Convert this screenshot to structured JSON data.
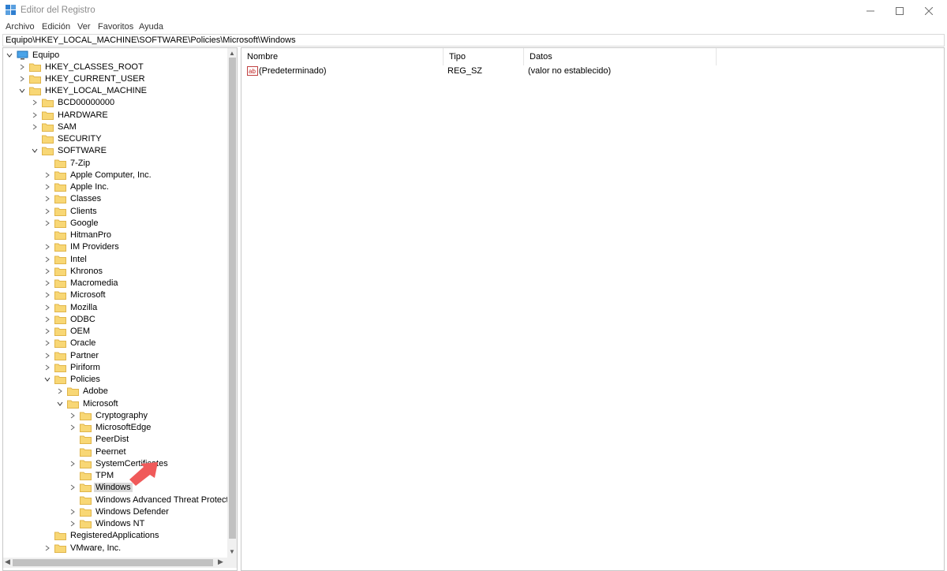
{
  "window": {
    "title": "Editor del Registro",
    "controls": {
      "minimize": "minimize-icon",
      "maximize": "maximize-icon",
      "close": "close-icon"
    }
  },
  "menu": [
    "Archivo",
    "Edición",
    "Ver",
    "Favoritos",
    "Ayuda"
  ],
  "address": "Equipo\\HKEY_LOCAL_MACHINE\\SOFTWARE\\Policies\\Microsoft\\Windows",
  "tree": {
    "root": "Equipo",
    "nodes": [
      {
        "label": "HKEY_CLASSES_ROOT",
        "depth": 1,
        "state": "collapsed"
      },
      {
        "label": "HKEY_CURRENT_USER",
        "depth": 1,
        "state": "collapsed"
      },
      {
        "label": "HKEY_LOCAL_MACHINE",
        "depth": 1,
        "state": "expanded"
      },
      {
        "label": "BCD00000000",
        "depth": 2,
        "state": "collapsed"
      },
      {
        "label": "HARDWARE",
        "depth": 2,
        "state": "collapsed"
      },
      {
        "label": "SAM",
        "depth": 2,
        "state": "collapsed"
      },
      {
        "label": "SECURITY",
        "depth": 2,
        "state": "leaf"
      },
      {
        "label": "SOFTWARE",
        "depth": 2,
        "state": "expanded"
      },
      {
        "label": "7-Zip",
        "depth": 3,
        "state": "leaf"
      },
      {
        "label": "Apple Computer, Inc.",
        "depth": 3,
        "state": "collapsed"
      },
      {
        "label": "Apple Inc.",
        "depth": 3,
        "state": "collapsed"
      },
      {
        "label": "Classes",
        "depth": 3,
        "state": "collapsed"
      },
      {
        "label": "Clients",
        "depth": 3,
        "state": "collapsed"
      },
      {
        "label": "Google",
        "depth": 3,
        "state": "collapsed"
      },
      {
        "label": "HitmanPro",
        "depth": 3,
        "state": "leaf"
      },
      {
        "label": "IM Providers",
        "depth": 3,
        "state": "collapsed"
      },
      {
        "label": "Intel",
        "depth": 3,
        "state": "collapsed"
      },
      {
        "label": "Khronos",
        "depth": 3,
        "state": "collapsed"
      },
      {
        "label": "Macromedia",
        "depth": 3,
        "state": "collapsed"
      },
      {
        "label": "Microsoft",
        "depth": 3,
        "state": "collapsed"
      },
      {
        "label": "Mozilla",
        "depth": 3,
        "state": "collapsed"
      },
      {
        "label": "ODBC",
        "depth": 3,
        "state": "collapsed"
      },
      {
        "label": "OEM",
        "depth": 3,
        "state": "collapsed"
      },
      {
        "label": "Oracle",
        "depth": 3,
        "state": "collapsed"
      },
      {
        "label": "Partner",
        "depth": 3,
        "state": "collapsed"
      },
      {
        "label": "Piriform",
        "depth": 3,
        "state": "collapsed"
      },
      {
        "label": "Policies",
        "depth": 3,
        "state": "expanded"
      },
      {
        "label": "Adobe",
        "depth": 4,
        "state": "collapsed"
      },
      {
        "label": "Microsoft",
        "depth": 4,
        "state": "expanded"
      },
      {
        "label": "Cryptography",
        "depth": 5,
        "state": "collapsed"
      },
      {
        "label": "MicrosoftEdge",
        "depth": 5,
        "state": "collapsed"
      },
      {
        "label": "PeerDist",
        "depth": 5,
        "state": "leaf"
      },
      {
        "label": "Peernet",
        "depth": 5,
        "state": "leaf"
      },
      {
        "label": "SystemCertificates",
        "depth": 5,
        "state": "collapsed"
      },
      {
        "label": "TPM",
        "depth": 5,
        "state": "leaf"
      },
      {
        "label": "Windows",
        "depth": 5,
        "state": "collapsed",
        "selected": true
      },
      {
        "label": "Windows Advanced Threat Protection",
        "depth": 5,
        "state": "leaf"
      },
      {
        "label": "Windows Defender",
        "depth": 5,
        "state": "collapsed"
      },
      {
        "label": "Windows NT",
        "depth": 5,
        "state": "collapsed"
      },
      {
        "label": "RegisteredApplications",
        "depth": 3,
        "state": "leaf"
      },
      {
        "label": "VMware, Inc.",
        "depth": 3,
        "state": "collapsed"
      }
    ]
  },
  "list": {
    "columns": [
      "Nombre",
      "Tipo",
      "Datos"
    ],
    "rows": [
      {
        "icon": "string-value-icon",
        "name": "(Predeterminado)",
        "type": "REG_SZ",
        "data": "(valor no establecido)"
      }
    ]
  },
  "colors": {
    "folder": "#f8d775",
    "folder_edge": "#e0b54a",
    "selection": "#d9d9d9",
    "annotation_arrow": "#f05a5a"
  }
}
